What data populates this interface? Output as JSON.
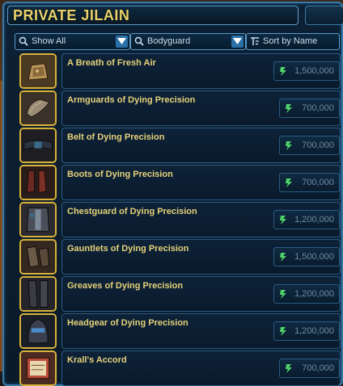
{
  "window": {
    "title": "PRIVATE JILAIN"
  },
  "filters": {
    "show": {
      "label": "Show All",
      "icon": "search-icon"
    },
    "category": {
      "label": "Bodyguard",
      "icon": "search-icon"
    },
    "sort": {
      "label": "Sort by Name",
      "icon": "sort-icon"
    }
  },
  "colors": {
    "title": "#e9d26a",
    "item_name": "#e6d27a",
    "price": "#6f8aa0",
    "credit_icon": "#4fd46a",
    "thumb_border": "#d9b23a",
    "frame_border": "#3a7aa8"
  },
  "items": [
    {
      "name": "A Breath of Fresh Air",
      "price": "1,500,000",
      "icon": "sack-icon"
    },
    {
      "name": "Armguards of Dying Precision",
      "price": "700,000",
      "icon": "armguard-icon"
    },
    {
      "name": "Belt of Dying Precision",
      "price": "700,000",
      "icon": "belt-icon"
    },
    {
      "name": "Boots of Dying Precision",
      "price": "700,000",
      "icon": "boots-icon"
    },
    {
      "name": "Chestguard of Dying Precision",
      "price": "1,200,000",
      "icon": "chestguard-icon"
    },
    {
      "name": "Gauntlets of Dying Precision",
      "price": "1,500,000",
      "icon": "gauntlets-icon"
    },
    {
      "name": "Greaves of Dying Precision",
      "price": "1,200,000",
      "icon": "greaves-icon"
    },
    {
      "name": "Headgear of Dying Precision",
      "price": "1,200,000",
      "icon": "headgear-icon"
    },
    {
      "name": "Krall's Accord",
      "price": "700,000",
      "icon": "scroll-icon"
    }
  ]
}
